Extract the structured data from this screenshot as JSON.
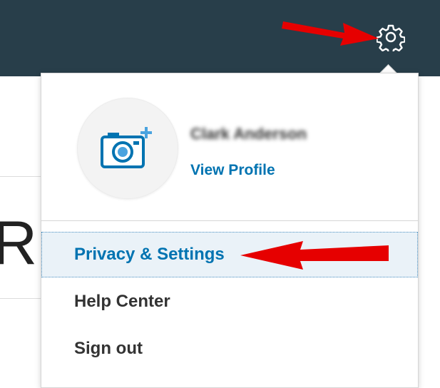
{
  "header": {
    "settings_icon": "gear-icon"
  },
  "profile": {
    "name": "Clark Anderson",
    "view_profile_label": "View Profile",
    "avatar_icon": "camera-plus-icon"
  },
  "menu": {
    "items": [
      {
        "label": "Privacy & Settings",
        "highlighted": true
      },
      {
        "label": "Help Center",
        "highlighted": false
      },
      {
        "label": "Sign out",
        "highlighted": false
      }
    ]
  },
  "colors": {
    "header_bg": "#283e4a",
    "link_blue": "#0073b1",
    "highlight_bg": "#eaf2f8",
    "annotation_red": "#e60000"
  }
}
